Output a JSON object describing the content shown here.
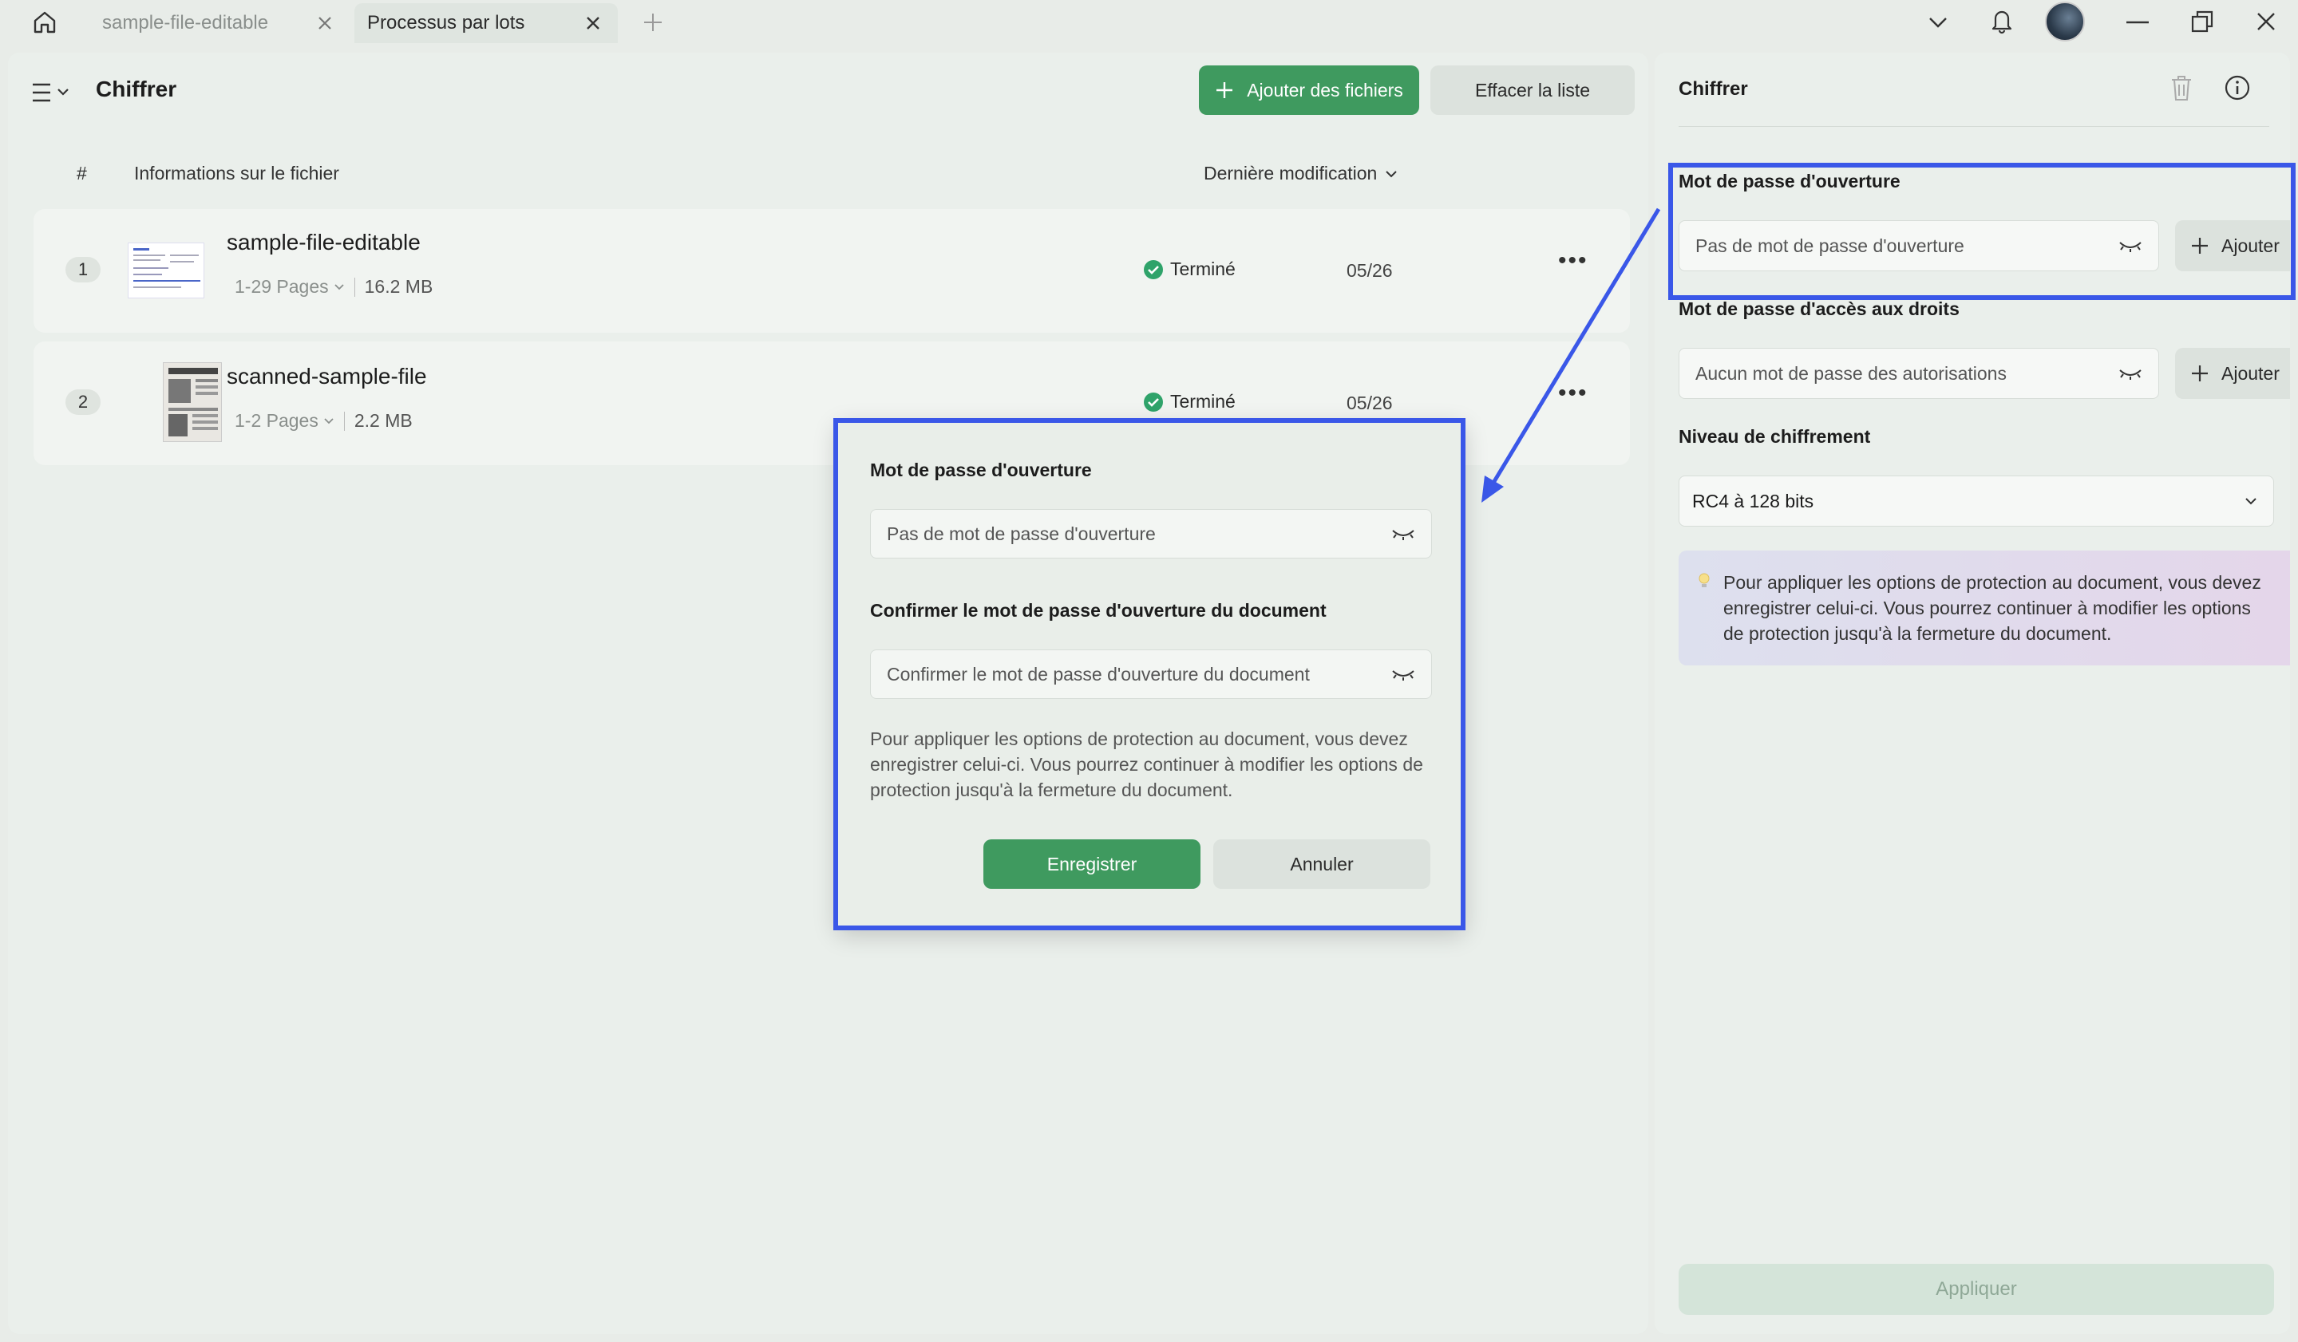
{
  "tabs": [
    {
      "label": "sample-file-editable"
    },
    {
      "label": "Processus par lots"
    }
  ],
  "header": {
    "title": "Chiffrer",
    "add_files": "Ajouter des fichiers",
    "clear_list": "Effacer la liste"
  },
  "table": {
    "col_num": "#",
    "col_info": "Informations sur le fichier",
    "col_modified": "Dernière modification",
    "rows": [
      {
        "num": "1",
        "name": "sample-file-editable",
        "pages": "1-29 Pages",
        "size": "16.2 MB",
        "status": "Terminé",
        "date": "05/26"
      },
      {
        "num": "2",
        "name": "scanned-sample-file",
        "pages": "1-2 Pages",
        "size": "2.2 MB",
        "status": "Terminé",
        "date": "05/26"
      }
    ]
  },
  "modal": {
    "open_pw_label": "Mot de passe d'ouverture",
    "open_pw_placeholder": "Pas de mot de passe d'ouverture",
    "confirm_label": "Confirmer le mot de passe d'ouverture du document",
    "confirm_placeholder": "Confirmer le mot de passe d'ouverture du document",
    "note": "Pour appliquer les options de protection au document, vous devez enregistrer celui-ci. Vous pourrez continuer à modifier les options de protection jusqu'à la fermeture du document.",
    "save": "Enregistrer",
    "cancel": "Annuler"
  },
  "side": {
    "title": "Chiffrer",
    "open_pw_label": "Mot de passe d'ouverture",
    "open_pw_value": "Pas de mot de passe d'ouverture",
    "add": "Ajouter",
    "perm_label": "Mot de passe d'accès aux droits",
    "perm_value": "Aucun mot de passe des autorisations",
    "level_label": "Niveau de chiffrement",
    "level_value": "RC4 à 128 bits",
    "tip": "Pour appliquer les options de protection au document, vous devez enregistrer celui-ci. Vous pourrez continuer à modifier les options de protection jusqu'à la fermeture du document.",
    "apply": "Appliquer"
  },
  "colors": {
    "accent_green": "#3f9a5f",
    "highlight_blue": "#3a57e8",
    "tip_bg": "#ddd7ee"
  }
}
